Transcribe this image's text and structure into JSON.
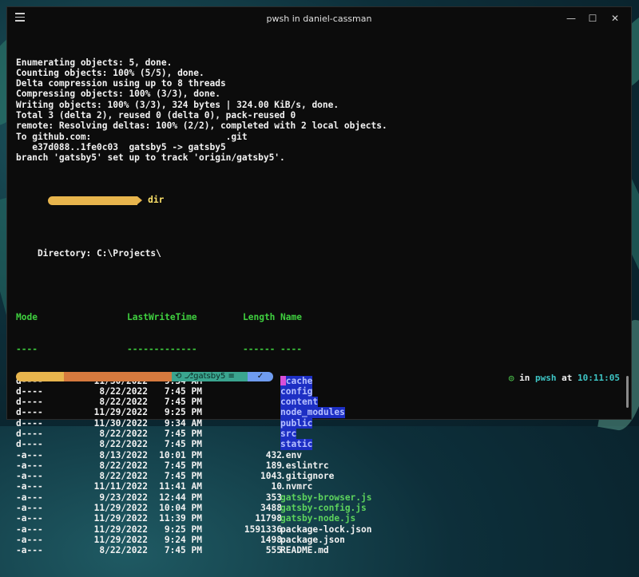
{
  "window": {
    "title": "pwsh in daniel-cassman",
    "minimize": "—",
    "maximize": "☐",
    "close": "✕"
  },
  "output_lines": [
    "Enumerating objects: 5, done.",
    "Counting objects: 100% (5/5), done.",
    "Delta compression using up to 8 threads",
    "Compressing objects: 100% (3/3), done.",
    "Writing objects: 100% (3/3), 324 bytes | 324.00 KiB/s, done.",
    "Total 3 (delta 2), reused 0 (delta 0), pack-reused 0",
    "remote: Resolving deltas: 100% (2/2), completed with 2 local objects.",
    "To github.com:                         .git",
    "   e37d088..1fe0c03  gatsby5 -> gatsby5",
    "branch 'gatsby5' set up to track 'origin/gatsby5'."
  ],
  "prompt": {
    "command": "dir"
  },
  "directory_line": "    Directory: C:\\Projects\\",
  "table": {
    "headers": {
      "mode": "Mode",
      "lastwrite": "LastWriteTime",
      "length": "Length",
      "name": "Name"
    },
    "underlines": {
      "mode": "----",
      "lastwrite": "-------------",
      "length": "------",
      "name": "----"
    },
    "rows": [
      {
        "mode": "d----",
        "date": "11/30/2022",
        "time": "9:34 AM",
        "length": "",
        "name": "cache",
        "style": "dir"
      },
      {
        "mode": "d----",
        "date": "8/22/2022",
        "time": "7:45 PM",
        "length": "",
        "name": "config",
        "style": "dir"
      },
      {
        "mode": "d----",
        "date": "8/22/2022",
        "time": "7:45 PM",
        "length": "",
        "name": "content",
        "style": "dir"
      },
      {
        "mode": "d----",
        "date": "11/29/2022",
        "time": "9:25 PM",
        "length": "",
        "name": "node_modules",
        "style": "dir"
      },
      {
        "mode": "d----",
        "date": "11/30/2022",
        "time": "9:34 AM",
        "length": "",
        "name": "public",
        "style": "dir"
      },
      {
        "mode": "d----",
        "date": "8/22/2022",
        "time": "7:45 PM",
        "length": "",
        "name": "src",
        "style": "dir"
      },
      {
        "mode": "d----",
        "date": "8/22/2022",
        "time": "7:45 PM",
        "length": "",
        "name": "static",
        "style": "dir"
      },
      {
        "mode": "-a---",
        "date": "8/13/2022",
        "time": "10:01 PM",
        "length": "432",
        "name": ".env",
        "style": "file"
      },
      {
        "mode": "-a---",
        "date": "8/22/2022",
        "time": "7:45 PM",
        "length": "189",
        "name": ".eslintrc",
        "style": "file"
      },
      {
        "mode": "-a---",
        "date": "8/22/2022",
        "time": "7:45 PM",
        "length": "1043",
        "name": ".gitignore",
        "style": "file"
      },
      {
        "mode": "-a---",
        "date": "11/11/2022",
        "time": "11:41 AM",
        "length": "10",
        "name": ".nvmrc",
        "style": "file"
      },
      {
        "mode": "-a---",
        "date": "9/23/2022",
        "time": "12:44 PM",
        "length": "353",
        "name": "gatsby-browser.js",
        "style": "js"
      },
      {
        "mode": "-a---",
        "date": "11/29/2022",
        "time": "10:04 PM",
        "length": "3488",
        "name": "gatsby-config.js",
        "style": "js"
      },
      {
        "mode": "-a---",
        "date": "11/29/2022",
        "time": "11:39 PM",
        "length": "11798",
        "name": "gatsby-node.js",
        "style": "js"
      },
      {
        "mode": "-a---",
        "date": "11/29/2022",
        "time": "9:25 PM",
        "length": "1591336",
        "name": "package-lock.json",
        "style": "file"
      },
      {
        "mode": "-a---",
        "date": "11/29/2022",
        "time": "9:24 PM",
        "length": "1498",
        "name": "package.json",
        "style": "file"
      },
      {
        "mode": "-a---",
        "date": "8/22/2022",
        "time": "7:45 PM",
        "length": "555",
        "name": "README.md",
        "style": "file"
      }
    ]
  },
  "statusbar": {
    "branch": "gatsby5",
    "branch_prefix": "⎇",
    "stash": "≡",
    "git_icon": "⟲",
    "check": "✓",
    "right_in": "in",
    "right_shell": "pwsh",
    "right_at": "at",
    "right_time": "10:11:05",
    "right_icon": "◎"
  },
  "colors": {
    "yellow_segment": "#e8b54d",
    "orange_segment": "#d67a3e",
    "teal_segment": "#3aa58f",
    "blue_segment": "#6f9cf0",
    "cursor": "#d94fd9",
    "dir_highlight": "#1d2fc4"
  }
}
